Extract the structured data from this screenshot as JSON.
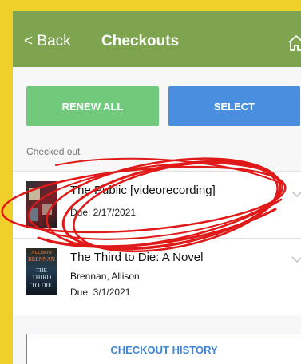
{
  "header": {
    "back_label": "Back",
    "title": "Checkouts"
  },
  "actions": {
    "renew_all_label": "RENEW ALL",
    "select_label": "SELECT"
  },
  "section_label": "Checked out",
  "checkouts": [
    {
      "title": "The Public [videorecording]",
      "author": "",
      "due": "Due: 2/17/2021"
    },
    {
      "title": "The Third to Die: A Novel",
      "author": "Brennan, Allison",
      "due": "Due: 3/1/2021"
    }
  ],
  "footer": {
    "history_label": "CHECKOUT HISTORY"
  },
  "colors": {
    "header_green": "#7ea450",
    "renew_green": "#71c97c",
    "select_blue": "#4a8fdf",
    "annotation_red": "#e01919",
    "page_yellow": "#f1cf2b"
  },
  "icons": [
    "back-chevron-icon",
    "home-icon",
    "chevron-down-icon"
  ]
}
